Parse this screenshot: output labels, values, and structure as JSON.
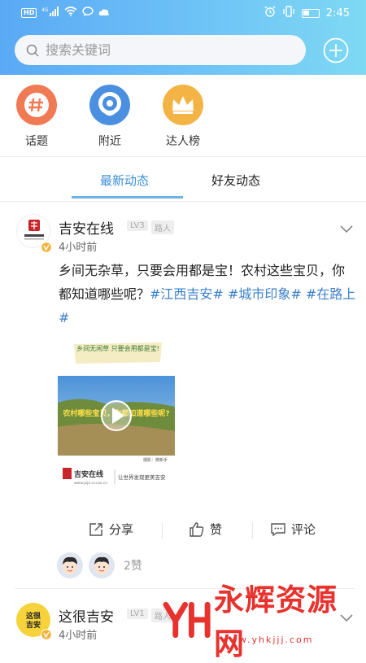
{
  "statusbar": {
    "hd": "HD",
    "network": "4G",
    "time": "2:45"
  },
  "search": {
    "placeholder": "搜索关键词"
  },
  "quick_links": [
    {
      "label": "话题",
      "icon": "hash-icon",
      "color": "#f07a54"
    },
    {
      "label": "附近",
      "icon": "location-icon",
      "color": "#4a8fe0"
    },
    {
      "label": "达人榜",
      "icon": "crown-icon",
      "color": "#f3b445"
    }
  ],
  "tabs": [
    {
      "label": "最新动态"
    },
    {
      "label": "好友动态"
    }
  ],
  "post": {
    "author": "吉安在线",
    "level": "LV3",
    "role": "路人",
    "time": "4小时前",
    "text_plain": "乡间无杂草，只要会用都是宝！农村这些宝贝，你都知道哪些呢？",
    "tags": [
      "#江西吉安#",
      "#城市印象#",
      "#在路上#"
    ],
    "media": {
      "banner": "乡间无闲草 只要会用都是宝!",
      "overlay": "农村哪些宝贝，你都知道哪些呢?",
      "credit": "摄影：微新手",
      "brand": "吉安在线",
      "brand_url": "www.jaja.cccoo.cn",
      "slogan": "让世界发现更美吉安"
    },
    "actions": {
      "share": "分享",
      "like": "赞",
      "comment": "评论"
    },
    "likes": "2赞"
  },
  "post2": {
    "author": "这很吉安",
    "level": "LV1",
    "role": "路人",
    "time": "4小时前",
    "avatar_text": "这很吉安"
  },
  "watermark": {
    "text": "永辉资源网",
    "url": "www.yhkjjj.com"
  }
}
